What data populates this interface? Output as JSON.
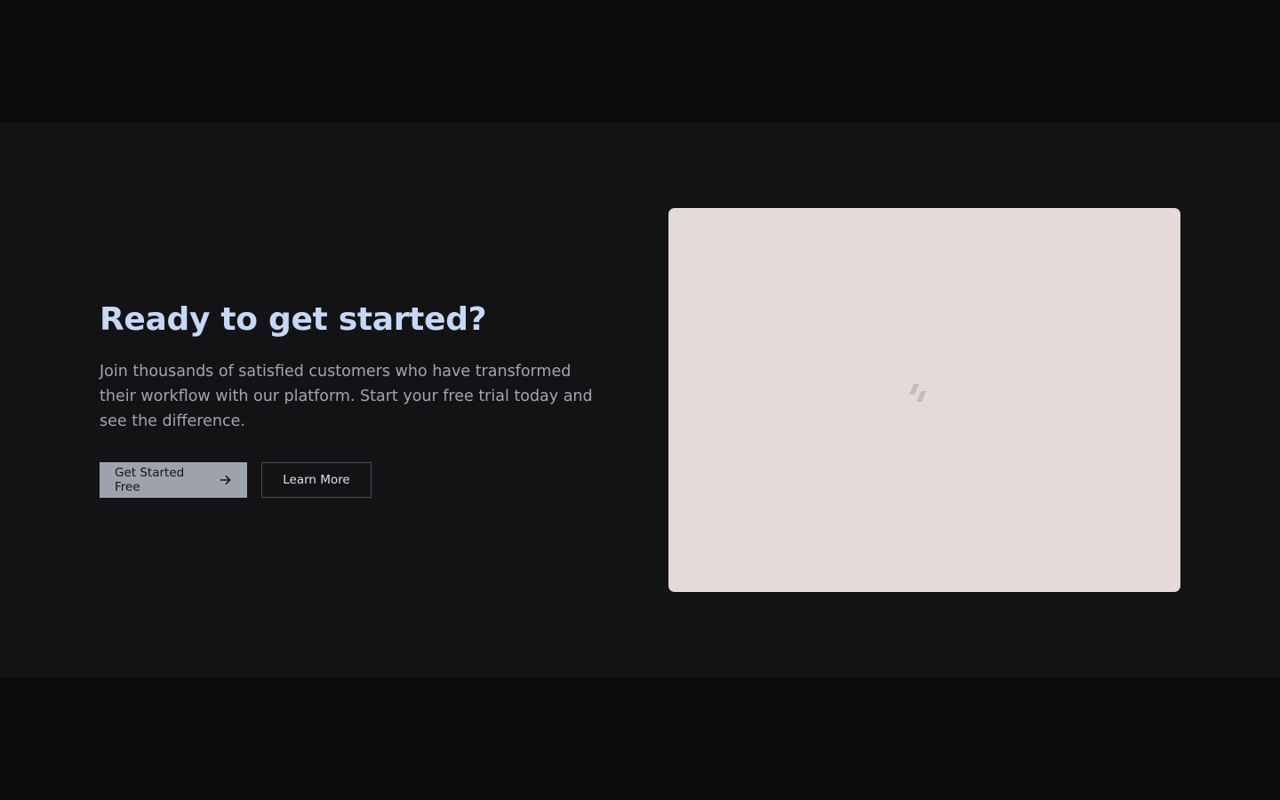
{
  "cta": {
    "headline": "Ready to get started?",
    "subtext": "Join thousands of satisfied customers who have transformed their workflow with our platform. Start your free trial today and see the difference.",
    "primary_label": "Get Started Free",
    "primary_icon": "arrow-right-icon",
    "secondary_label": "Learn More"
  },
  "media": {
    "icon": "image-placeholder-icon"
  },
  "colors": {
    "page_background": "#0b0b0d",
    "band_background": "#131316",
    "headline": "#c6d8f5",
    "subtext": "#a2a5ad",
    "primary_button_bg": "#9ea2ad",
    "primary_button_text": "#111216",
    "secondary_button_border": "#4a4d56",
    "secondary_button_text": "#dde1ea",
    "media_background": "#e6d9d9",
    "media_icon": "#c5bcbd"
  }
}
